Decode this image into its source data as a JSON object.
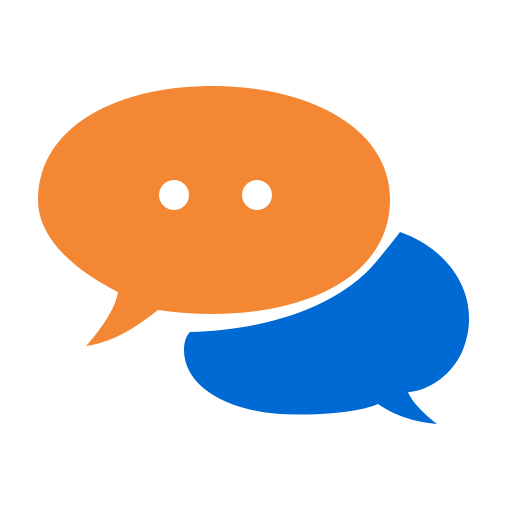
{
  "colors": {
    "background": "#ffffff",
    "front_bubble": "#f38733",
    "back_bubble": "#006ad4",
    "dots": "#ffffff"
  },
  "icons": {
    "front": "chat-bubble-icon",
    "back": "chat-bubble-icon",
    "typing": "typing-dots-icon"
  }
}
